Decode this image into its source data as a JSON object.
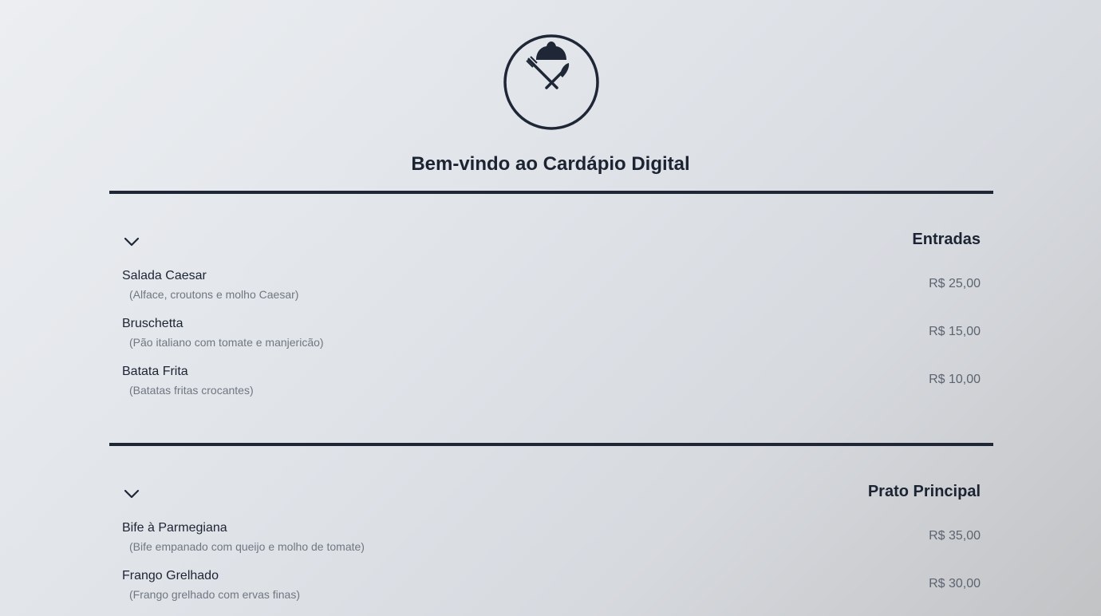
{
  "header": {
    "logo_icon": "chef-hat-cutlery-icon",
    "title": "Bem-vindo ao Cardápio Digital"
  },
  "colors": {
    "primary": "#1f2736",
    "text": "#1c2433",
    "muted": "#6f7782"
  },
  "sections": [
    {
      "title": "Entradas",
      "toggle_icon": "chevron-down-icon",
      "items": [
        {
          "name": "Salada Caesar",
          "description": "(Alface, croutons e molho Caesar)",
          "price": "R$ 25,00"
        },
        {
          "name": "Bruschetta",
          "description": "(Pão italiano com tomate e manjericão)",
          "price": "R$ 15,00"
        },
        {
          "name": "Batata Frita",
          "description": "(Batatas fritas crocantes)",
          "price": "R$ 10,00"
        }
      ]
    },
    {
      "title": "Prato Principal",
      "toggle_icon": "chevron-down-icon",
      "items": [
        {
          "name": "Bife à Parmegiana",
          "description": "(Bife empanado com queijo e molho de tomate)",
          "price": "R$ 35,00"
        },
        {
          "name": "Frango Grelhado",
          "description": "(Frango grelhado com ervas finas)",
          "price": "R$ 30,00"
        }
      ]
    }
  ]
}
